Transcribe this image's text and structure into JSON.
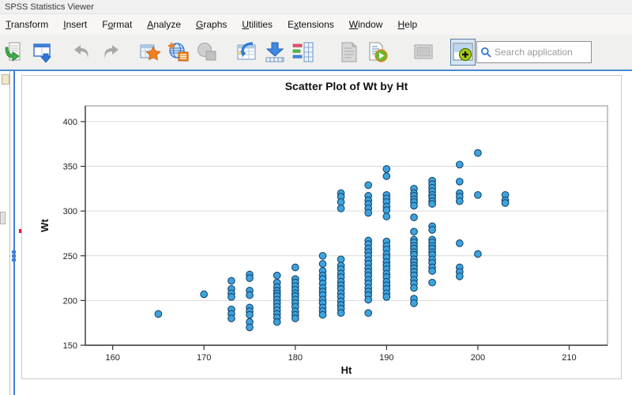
{
  "window": {
    "title": "SPSS Statistics Viewer"
  },
  "menu_bar": {
    "items": [
      {
        "label": "Transform",
        "mnemonic": "T"
      },
      {
        "label": "Insert",
        "mnemonic": "I"
      },
      {
        "label": "Format",
        "mnemonic": "o"
      },
      {
        "label": "Analyze",
        "mnemonic": "A"
      },
      {
        "label": "Graphs",
        "mnemonic": "G"
      },
      {
        "label": "Utilities",
        "mnemonic": "U"
      },
      {
        "label": "Extensions",
        "mnemonic": "x"
      },
      {
        "label": "Window",
        "mnemonic": "W"
      },
      {
        "label": "Help",
        "mnemonic": "H"
      }
    ]
  },
  "toolbar": {
    "buttons": [
      {
        "name": "export-output-icon",
        "state": "normal"
      },
      {
        "name": "print-preview-icon",
        "state": "normal"
      },
      {
        "name": "undo-icon",
        "state": "disabled"
      },
      {
        "name": "redo-icon",
        "state": "disabled"
      },
      {
        "name": "recall-dialog-icon",
        "state": "normal"
      },
      {
        "name": "go-to-data-icon",
        "state": "normal"
      },
      {
        "name": "go-to-variable-icon",
        "state": "disabled"
      },
      {
        "name": "variables-icon",
        "state": "normal"
      },
      {
        "name": "insert-cases-icon",
        "state": "normal"
      },
      {
        "name": "use-variable-sets-icon",
        "state": "normal"
      },
      {
        "name": "show-results-icon",
        "state": "disabled"
      },
      {
        "name": "run-script-icon",
        "state": "normal"
      },
      {
        "name": "export-image-icon",
        "state": "disabled"
      },
      {
        "name": "activate-chart-icon",
        "state": "selected"
      }
    ],
    "search": {
      "placeholder": "Search application",
      "icon": "search-icon"
    }
  },
  "chart_data": {
    "type": "scatter",
    "title": "Scatter Plot of Wt by Ht",
    "xlabel": "Ht",
    "ylabel": "Wt",
    "xlim": [
      157,
      214.2
    ],
    "ylim": [
      150,
      417.6
    ],
    "x_ticks": [
      160,
      170,
      180,
      190,
      200,
      210
    ],
    "y_ticks": [
      150,
      200,
      250,
      300,
      350,
      400
    ],
    "grid": "horizontal-only",
    "legend": "none",
    "marker": {
      "shape": "circle",
      "fill": "#3DA3DF",
      "stroke": "#17476B",
      "radius": 4.3
    },
    "columns": [
      {
        "ht": 165,
        "wt": [
          185
        ]
      },
      {
        "ht": 170,
        "wt": [
          207
        ]
      },
      {
        "ht": 173,
        "wt": [
          222,
          213,
          208,
          204,
          190,
          185,
          180
        ]
      },
      {
        "ht": 175,
        "wt": [
          229,
          225,
          211,
          206,
          192,
          188,
          184,
          176,
          170
        ]
      },
      {
        "ht": 178,
        "wt": [
          228,
          220,
          215,
          211,
          208,
          205,
          201,
          197,
          193,
          189,
          185,
          181,
          176
        ]
      },
      {
        "ht": 180,
        "wt": [
          237,
          224,
          220,
          216,
          212,
          208,
          205,
          201,
          197,
          193,
          188,
          184,
          180
        ]
      },
      {
        "ht": 183,
        "wt": [
          250,
          241,
          233,
          228,
          224,
          219,
          214,
          210,
          206,
          201,
          197,
          192,
          188,
          184
        ]
      },
      {
        "ht": 185,
        "wt": [
          320,
          316,
          310,
          303,
          246,
          239,
          235,
          230,
          226,
          221,
          217,
          213,
          208,
          204,
          199,
          195,
          191,
          186
        ]
      },
      {
        "ht": 188,
        "wt": [
          329,
          317,
          312,
          308,
          303,
          298,
          267,
          263,
          258,
          254,
          250,
          245,
          241,
          236,
          232,
          228,
          223,
          219,
          214,
          210,
          206,
          201,
          186
        ]
      },
      {
        "ht": 190,
        "wt": [
          347,
          339,
          318,
          314,
          310,
          305,
          301,
          294,
          266,
          261,
          257,
          252,
          248,
          243,
          239,
          235,
          230,
          226,
          221,
          217,
          213,
          208,
          204
        ]
      },
      {
        "ht": 193,
        "wt": [
          325,
          320,
          317,
          313,
          310,
          306,
          293,
          277,
          268,
          265,
          261,
          258,
          254,
          251,
          246,
          243,
          239,
          236,
          232,
          228,
          223,
          219,
          214,
          202,
          197
        ]
      },
      {
        "ht": 195,
        "wt": [
          334,
          330,
          326,
          322,
          318,
          315,
          311,
          308,
          283,
          279,
          268,
          265,
          261,
          258,
          254,
          251,
          246,
          242,
          237,
          233,
          220
        ]
      },
      {
        "ht": 198,
        "wt": [
          352,
          333,
          320,
          316,
          311,
          264,
          237,
          232,
          227
        ]
      },
      {
        "ht": 200,
        "wt": [
          365,
          318,
          252
        ]
      },
      {
        "ht": 203,
        "wt": [
          318,
          312,
          309
        ]
      }
    ]
  },
  "colors": {
    "accent_blue": "#3F7ED8",
    "point_fill": "#3DA3DF",
    "red_marker": "#E8112D",
    "toolbar_bg": "#F0F0EF",
    "gridline": "#D9D9D9"
  }
}
